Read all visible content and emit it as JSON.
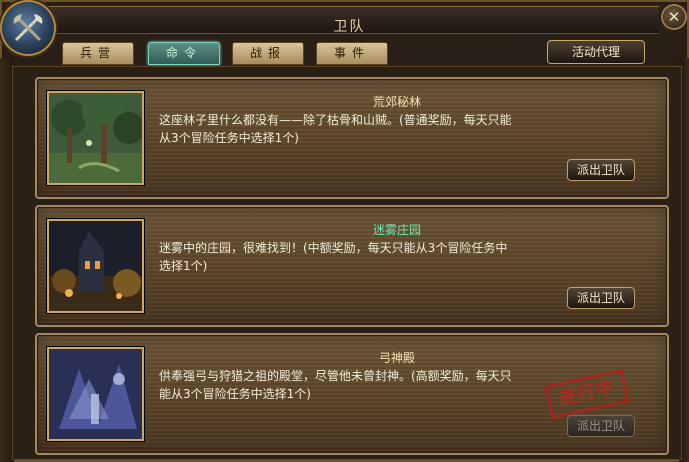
{
  "window": {
    "title": "卫队"
  },
  "tabs": [
    {
      "label": "兵营",
      "active": false
    },
    {
      "label": "命令",
      "active": true
    },
    {
      "label": "战报",
      "active": false
    },
    {
      "label": "事件",
      "active": false
    }
  ],
  "agent_button": "活动代理",
  "close_glyph": "✕",
  "missions": [
    {
      "name": "荒郊秘林",
      "name_color": "#f3e3b8",
      "desc_line1": "这座林子里什么都没有——除了枯骨和山贼。(普通奖励，每天只能",
      "desc_line2": "从3个冒险任务中选择1个)",
      "button": "派出卫队",
      "status": ""
    },
    {
      "name": "迷雾庄园",
      "name_color": "#6ee7b0",
      "desc_line1": "迷雾中的庄园，很难找到！(中额奖励，每天只能从3个冒险任务中",
      "desc_line2": "选择1个)",
      "button": "派出卫队",
      "status": ""
    },
    {
      "name": "弓神殿",
      "name_color": "#f3e3b8",
      "desc_line1": "供奉强弓与狩猎之祖的殿堂，尽管他未曾封神。(高额奖励，每天只",
      "desc_line2": "能从3个冒险任务中选择1个)",
      "button": "派出卫队",
      "status": "进行中"
    }
  ],
  "icons": {
    "emblem": "crossed-axes-emblem-icon",
    "close": "close-icon"
  }
}
